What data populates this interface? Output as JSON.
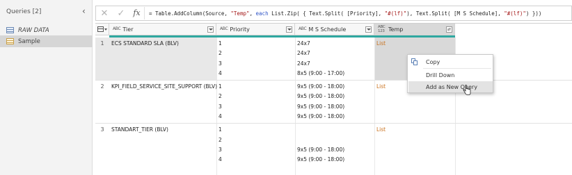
{
  "queries_pane": {
    "title": "Queries [2]",
    "items": [
      {
        "label": "RAW DATA"
      },
      {
        "label": "Sample"
      }
    ]
  },
  "formula_bar": {
    "cancel_icon": "close-icon",
    "confirm_icon": "check-icon",
    "fx": "fx",
    "formula": "= Table.AddColumn(Source, \"Temp\", each List.Zip( { Text.Split( [Priority], \"#(lf)\"), Text.Split( [M S Schedule], \"#(lf)\") }))"
  },
  "grid": {
    "columns": [
      {
        "type": "ABC",
        "name": "Tier"
      },
      {
        "type": "ABC",
        "name": "Priority"
      },
      {
        "type": "ABC",
        "name": "M S Schedule"
      },
      {
        "type": "ABC 123",
        "name": "Temp"
      }
    ],
    "rows": [
      {
        "num": "1",
        "tier": "ECS STANDARD SLA (BLV)",
        "priority": [
          "1",
          "2",
          "3",
          "4"
        ],
        "schedule": [
          "24x7",
          "24x7",
          "24x7",
          "8x5 (9:00 - 17:00)"
        ],
        "temp": "List"
      },
      {
        "num": "2",
        "tier": "KPI_FIELD_SERVICE_SITE_SUPPORT (BLV)",
        "priority": [
          "1",
          "2",
          "3",
          "4"
        ],
        "schedule": [
          "9x5 (9:00 - 18:00)",
          "9x5 (9:00 - 18:00)",
          "9x5 (9:00 - 18:00)",
          "9x5 (9:00 - 18:00)"
        ],
        "temp": "List"
      },
      {
        "num": "3",
        "tier": "STANDART_TIER (BLV)",
        "priority": [
          "1",
          "2",
          "3",
          "4"
        ],
        "schedule": [
          "",
          "",
          "9x5 (9:00 - 18:00)",
          "9x5 (9:00 - 18:00)"
        ],
        "temp": "List"
      }
    ],
    "quality_bar_color": "#2fa8a0",
    "list_color": "#c9701b"
  },
  "context_menu": {
    "items": [
      {
        "label": "Copy",
        "icon": "copy-icon"
      },
      {
        "label": "Drill Down"
      },
      {
        "label": "Add as New Query"
      }
    ]
  }
}
